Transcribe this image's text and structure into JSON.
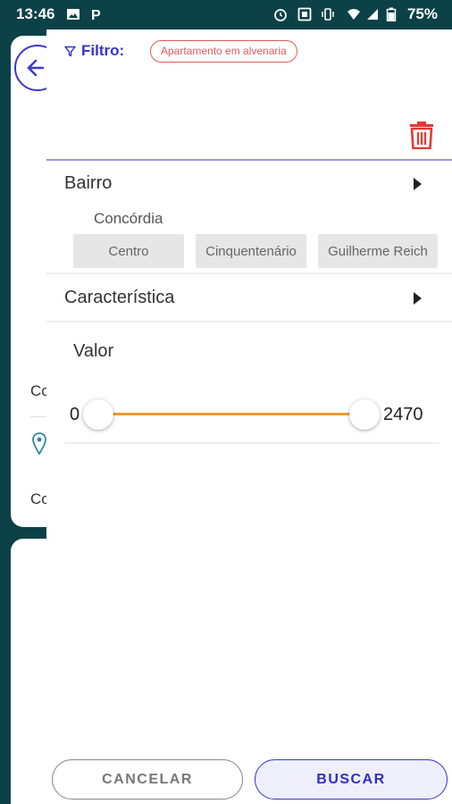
{
  "status_bar": {
    "time": "13:46",
    "battery": "75%",
    "icons": [
      "image-icon",
      "parking-icon",
      "alarm-icon",
      "nfc-icon",
      "vibrate-icon",
      "wifi-icon",
      "signal-icon",
      "battery-icon"
    ]
  },
  "background": {
    "text1": "Co",
    "text2": "Co"
  },
  "filter": {
    "label": "Filtro:",
    "chip": "Apartamento em alvenaria"
  },
  "bairro": {
    "title": "Bairro",
    "city": "Concórdia",
    "neighborhoods": [
      "Centro",
      "Cinquentenário",
      "Guilherme Reich"
    ]
  },
  "caracteristica": {
    "title": "Característica"
  },
  "valor": {
    "title": "Valor",
    "min": "0",
    "max": "2470",
    "selected_min": 0,
    "selected_max": 2470
  },
  "actions": {
    "cancel": "CANCELAR",
    "search": "BUSCAR"
  },
  "colors": {
    "accent": "#3434c8",
    "chip": "#e25a5a",
    "trash": "#e53935",
    "slider": "#f09a2e",
    "status_bar": "#0b4147"
  }
}
